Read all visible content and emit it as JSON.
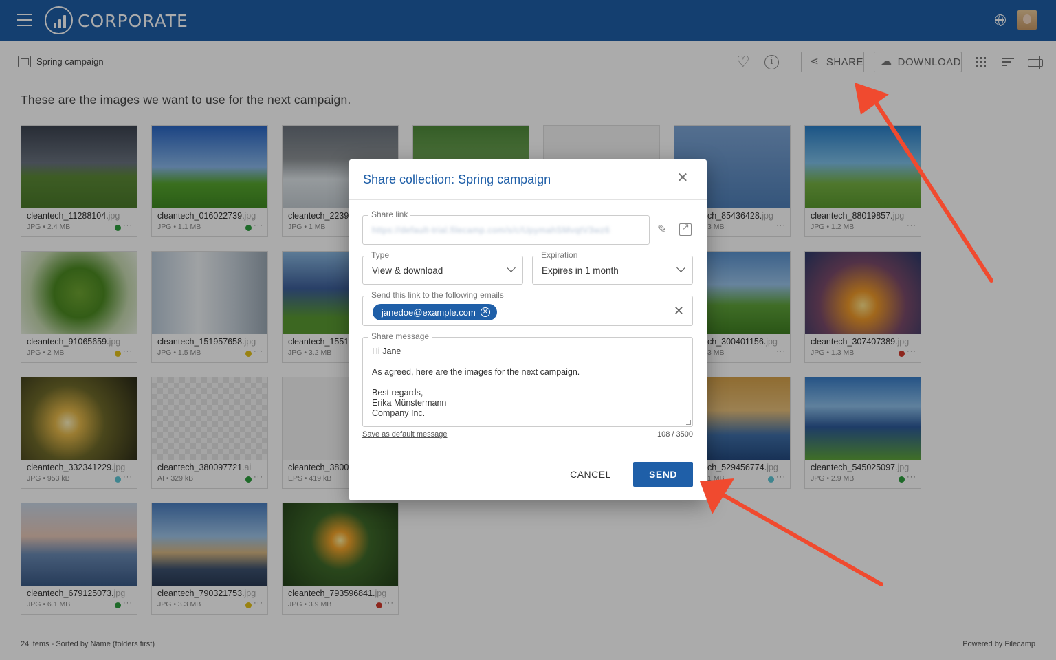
{
  "header": {
    "logo_text": "CORPORATE"
  },
  "toolbar": {
    "collection_title": "Spring campaign",
    "share_label": "SHARE",
    "download_label": "DOWNLOAD"
  },
  "description": "These are the images we want to use for the next campaign.",
  "tiles": [
    {
      "name": "cleantech_11288104.",
      "ext": "jpg",
      "meta": "JPG • 2.4 MB",
      "status": "#2e9e3e"
    },
    {
      "name": "cleantech_016022739.",
      "ext": "jpg",
      "meta": "JPG • 1.1 MB",
      "status": "#2e9e3e"
    },
    {
      "name": "cleantech_2239",
      "ext": "",
      "meta": "JPG • 1 MB",
      "status": ""
    },
    {
      "name": "",
      "ext": "",
      "meta": "",
      "status": ""
    },
    {
      "name": "",
      "ext": "",
      "meta": "",
      "status": ""
    },
    {
      "name": "ch_85436428.",
      "ext": "jpg",
      "meta": "3 MB",
      "status": ""
    },
    {
      "name": "cleantech_88019857.",
      "ext": "jpg",
      "meta": "JPG • 1.2 MB",
      "status": ""
    },
    {
      "name": "cleantech_91065659.",
      "ext": "jpg",
      "meta": "JPG • 2 MB",
      "status": "#e5c21a"
    },
    {
      "name": "cleantech_151957658.",
      "ext": "jpg",
      "meta": "JPG • 1.5 MB",
      "status": "#e5c21a"
    },
    {
      "name": "cleantech_1551",
      "ext": "",
      "meta": "JPG • 3.2 MB",
      "status": ""
    },
    {
      "name": "ch_300401156.",
      "ext": "jpg",
      "meta": "3 MB",
      "status": ""
    },
    {
      "name": "cleantech_307407389.",
      "ext": "jpg",
      "meta": "JPG • 1.3 MB",
      "status": "#d33a2c"
    },
    {
      "name": "cleantech_332341229.",
      "ext": "jpg",
      "meta": "JPG • 953 kB",
      "status": "#5fc6d6"
    },
    {
      "name": "cleantech_380097721.",
      "ext": "ai",
      "meta": "AI • 329 kB",
      "status": "#2e9e3e"
    },
    {
      "name": "cleantech_3800",
      "ext": "",
      "meta": "EPS • 419 kB",
      "status": ""
    },
    {
      "name": "ch_529456774.",
      "ext": "jpg",
      "meta": "1 MB",
      "status": "#5fc6d6"
    },
    {
      "name": "cleantech_545025097.",
      "ext": "jpg",
      "meta": "JPG • 2.9 MB",
      "status": "#2e9e3e"
    },
    {
      "name": "cleantech_679125073.",
      "ext": "jpg",
      "meta": "JPG • 6.1 MB",
      "status": "#2e9e3e"
    },
    {
      "name": "cleantech_790321753.",
      "ext": "jpg",
      "meta": "JPG • 3.3 MB",
      "status": "#e5c21a"
    },
    {
      "name": "cleantech_793596841.",
      "ext": "jpg",
      "meta": "JPG • 3.9 MB",
      "status": "#d33a2c"
    }
  ],
  "footer": {
    "status": "24 items - Sorted by Name (folders first)",
    "powered": "Powered by Filecamp"
  },
  "dialog": {
    "title": "Share collection: Spring campaign",
    "share_link_label": "Share link",
    "share_link_value": "https://default-trial.filecamp.com/s/c/UpymahSMvqtV3wz6",
    "type_label": "Type",
    "type_value": "View & download",
    "expiration_label": "Expiration",
    "expiration_value": "Expires in 1 month",
    "emails_label": "Send this link to the following emails",
    "email_chip": "janedoe@example.com",
    "message_label": "Share message",
    "message_body": "Hi Jane\n\nAs agreed, here are the images for the next campaign.\n\nBest regards,\nErika Münstermann\nCompany Inc.",
    "save_default": "Save as default message",
    "char_count": "108 / 3500",
    "cancel_label": "CANCEL",
    "send_label": "SEND"
  },
  "colors": {
    "brand": "#1f5fa8",
    "annotation_arrow": "#f04a2f"
  }
}
